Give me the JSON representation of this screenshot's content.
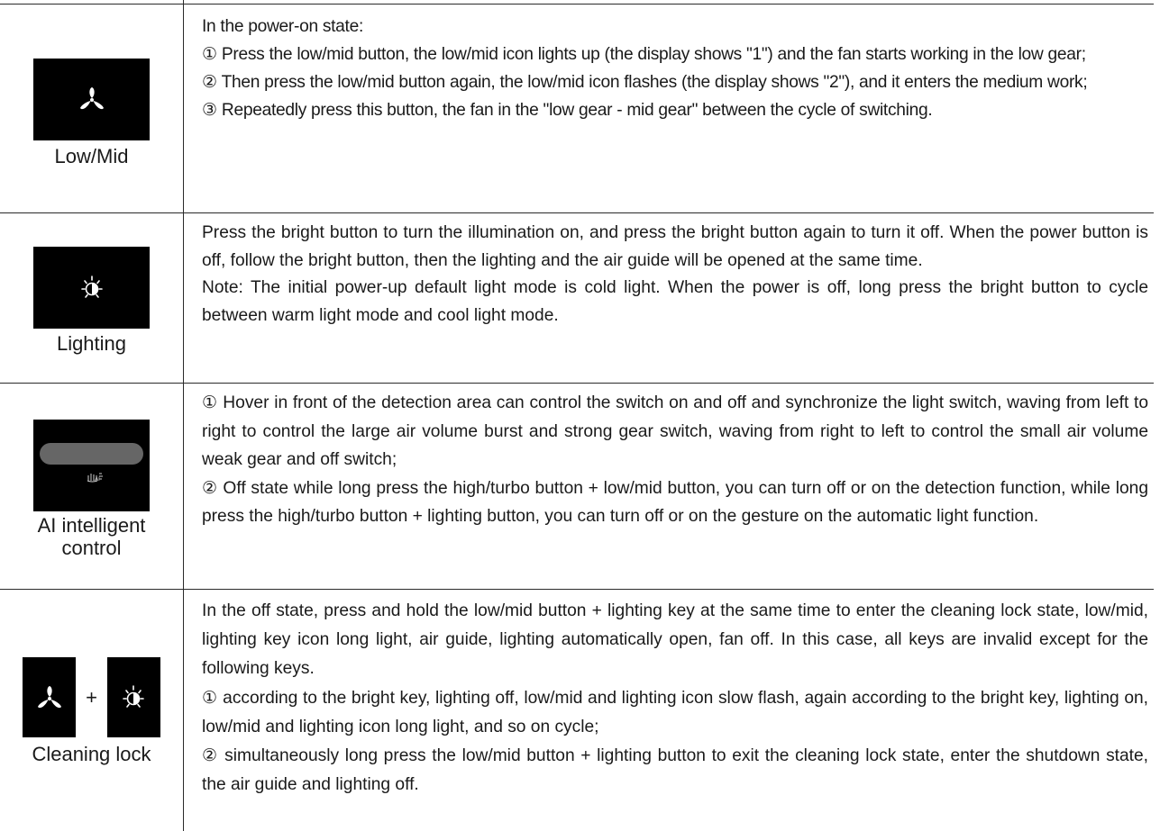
{
  "rows": [
    {
      "caption": "Low/Mid",
      "icon": "fan-icon",
      "lines": [
        "In the power-on state:",
        "① Press the low/mid button, the low/mid  icon lights up (the display shows \"1\") and the fan starts working in the low gear;",
        "② Then press the low/mid button again, the low/mid icon flashes (the display shows \"2\"), and it enters the medium work;",
        "③ Repeatedly press this button, the fan in the \"low gear - mid gear\" between the cycle of switching."
      ]
    },
    {
      "caption": "Lighting",
      "icon": "light-bulb-icon",
      "lines": [
        "Press the bright button to turn the illumination on, and press the bright button again to turn it off. When the power button is off, follow the bright button, then the lighting and the air guide will be opened at the same time.",
        "Note: The initial power-up default light mode is cold light. When the power is off, long press the bright button to cycle between warm light mode and cool light mode."
      ]
    },
    {
      "caption_line1": "AI intelligent",
      "caption_line2": "control",
      "icon": "hand-wave-icon",
      "icon_label": "AI",
      "lines": [
        "① Hover in front of the detection area can control the switch on and off and synchronize the light switch, waving from left to right to control the large air volume burst and strong gear switch, waving from right to left to control the small air volume weak gear and off switch;",
        "② Off state while long press the high/turbo button + low/mid button, you can turn off or on the detection function, while long press the high/turbo button + lighting button, you can turn off or on the gesture on the automatic light function."
      ]
    },
    {
      "caption": "Cleaning lock",
      "plus": "+",
      "icons": [
        "fan-icon",
        "light-bulb-icon"
      ],
      "lines": [
        "In the off state, press and hold the low/mid button + lighting key at the same time to enter the cleaning lock state, low/mid, lighting key icon long light, air guide, lighting automatically open, fan off. In this case, all keys are invalid except for the following keys.",
        "① according to the bright key, lighting off, low/mid  and lighting icon slow flash, again according to the bright key, lighting on, low/mid and lighting icon long light, and so on cycle;",
        "② simultaneously long press the low/mid button + lighting button to exit the cleaning lock state, enter the shutdown state, the air guide and lighting off."
      ]
    }
  ],
  "colors": {
    "panel": "#000000",
    "text": "#1a1a1a",
    "rule": "#2a2a2a",
    "gesture_bar": "#666666"
  }
}
